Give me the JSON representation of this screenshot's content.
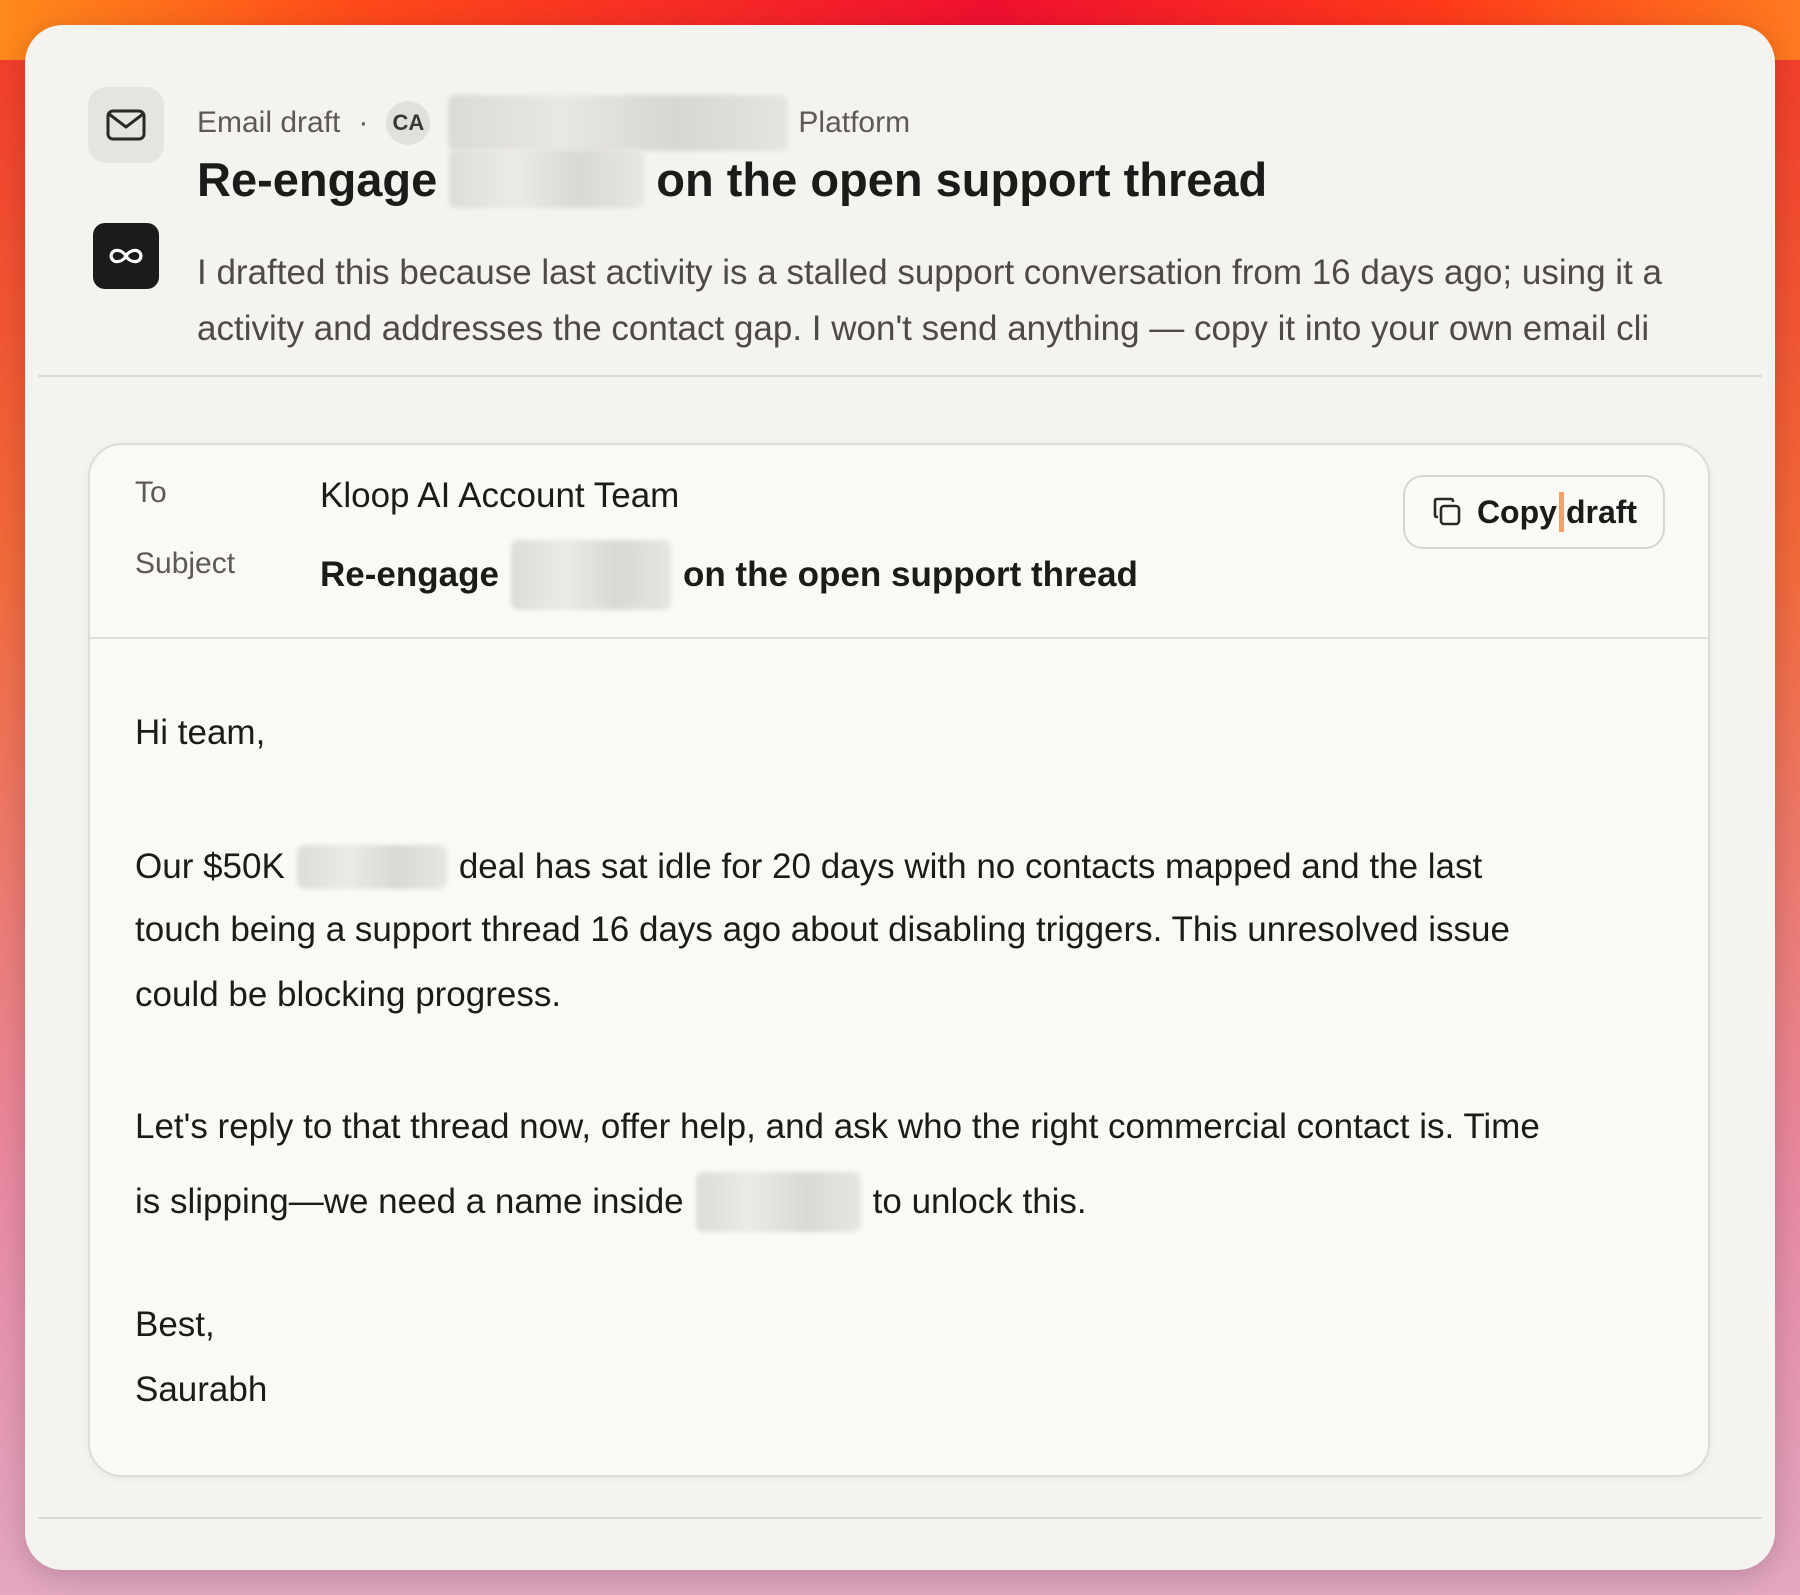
{
  "header": {
    "type_label": "Email draft",
    "separator": "·",
    "org_initials": "CA",
    "org_name_suffix": "Platform",
    "title_prefix": "Re-engage",
    "title_suffix": "on the open support thread"
  },
  "reasoning": {
    "line1": "I drafted this because last activity is a stalled support conversation from 16 days ago; using it a",
    "line2": "activity and addresses the contact gap. I won't send anything — copy it into your own email cli"
  },
  "email": {
    "to_label": "To",
    "to_value": "Kloop AI Account Team",
    "subject_label": "Subject",
    "subject_prefix": "Re-engage",
    "subject_suffix": "on the open support thread",
    "copy_button_label_1": "Copy",
    "copy_button_label_2": "draft",
    "greeting": "Hi team,",
    "p1_l1_prefix": "Our $50K",
    "p1_l1_suffix": "deal has sat idle for 20 days with no contacts mapped and the last",
    "p1_l2": "touch being a support thread 16 days ago about disabling triggers. This unresolved issue",
    "p1_l3": "could be blocking progress.",
    "p2_l1": "Let's reply to that thread now, offer help, and ask who the right commercial contact is. Time",
    "p2_l2_prefix": "is slipping—we need a name inside",
    "p2_l2_suffix": "to unlock this.",
    "signoff": "Best,",
    "signature": "Saurabh"
  },
  "icons": {
    "mail": "mail-icon",
    "agent": "infinity-icon",
    "copy": "copy-icon"
  },
  "colors": {
    "panel_bg": "#f4f3f0",
    "card_bg": "#faf9f6",
    "text_primary": "#1c1b19",
    "text_secondary": "#5d5a55",
    "agent_badge_bg": "#1c1b19"
  }
}
